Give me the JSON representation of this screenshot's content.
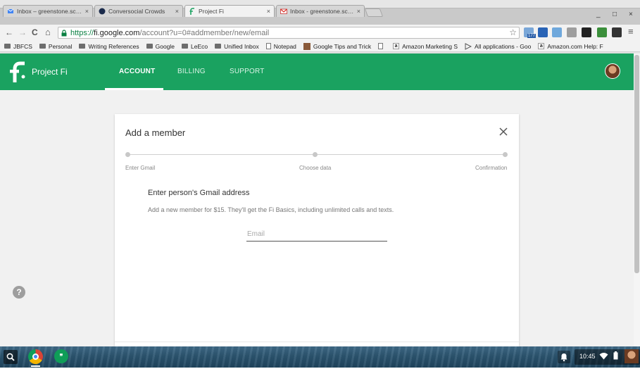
{
  "tabs": [
    {
      "label": "Inbox – greenstone.scott",
      "icon": "inbox-icon",
      "close": "×",
      "active": false
    },
    {
      "label": "Conversocial Crowds",
      "icon": "conversocial-icon",
      "close": "×",
      "active": false
    },
    {
      "label": "Project Fi",
      "icon": "project-fi-icon",
      "close": "×",
      "active": true
    },
    {
      "label": "Inbox - greenstone.scott",
      "icon": "gmail-icon",
      "close": "×",
      "active": false
    }
  ],
  "window_controls": {
    "minimize": "_",
    "maximize": "□",
    "close": "×"
  },
  "toolbar": {
    "back": "←",
    "forward": "→",
    "reload": "C",
    "home": "⌂",
    "url_scheme": "https://",
    "url_host": "fi.google.com",
    "url_path": "/account?u=0#addmember/new/email",
    "star": "☆",
    "extension_badge": "177",
    "menu": "≡"
  },
  "bookmarks": [
    {
      "label": "JBFCS",
      "icon": "folder-icon"
    },
    {
      "label": "Personal",
      "icon": "folder-icon"
    },
    {
      "label": "Writing References",
      "icon": "folder-icon"
    },
    {
      "label": "Google",
      "icon": "folder-icon"
    },
    {
      "label": "LeEco",
      "icon": "folder-icon"
    },
    {
      "label": "Unified Inbox",
      "icon": "folder-icon"
    },
    {
      "label": "Notepad",
      "icon": "page-icon"
    },
    {
      "label": "Google Tips and Trick",
      "icon": "bookmark-favicon"
    },
    {
      "label": "",
      "icon": "page-icon"
    },
    {
      "label": "Amazon Marketing S",
      "icon": "amazon-icon"
    },
    {
      "label": "All applications - Goo",
      "icon": "apps-icon"
    },
    {
      "label": "Amazon.com Help: F",
      "icon": "amazon-icon"
    }
  ],
  "header": {
    "brand": "Project Fi",
    "nav": [
      {
        "label": "ACCOUNT",
        "active": true
      },
      {
        "label": "BILLING",
        "active": false
      },
      {
        "label": "SUPPORT",
        "active": false
      }
    ]
  },
  "dialog": {
    "title": "Add a member",
    "steps": [
      "Enter Gmail",
      "Choose data",
      "Confirmation"
    ],
    "heading": "Enter person's Gmail address",
    "description": "Add a new member for $15. They'll get the Fi Basics, including unlimited calls and texts.",
    "email_value": "",
    "email_placeholder": "Email"
  },
  "help_glyph": "?",
  "shelf": {
    "hangouts_glyph": "❞",
    "time": "10:45"
  },
  "colors": {
    "fi_green": "#1aa260",
    "url_green": "#0b8043",
    "shelf_blue": "#2c5570"
  }
}
